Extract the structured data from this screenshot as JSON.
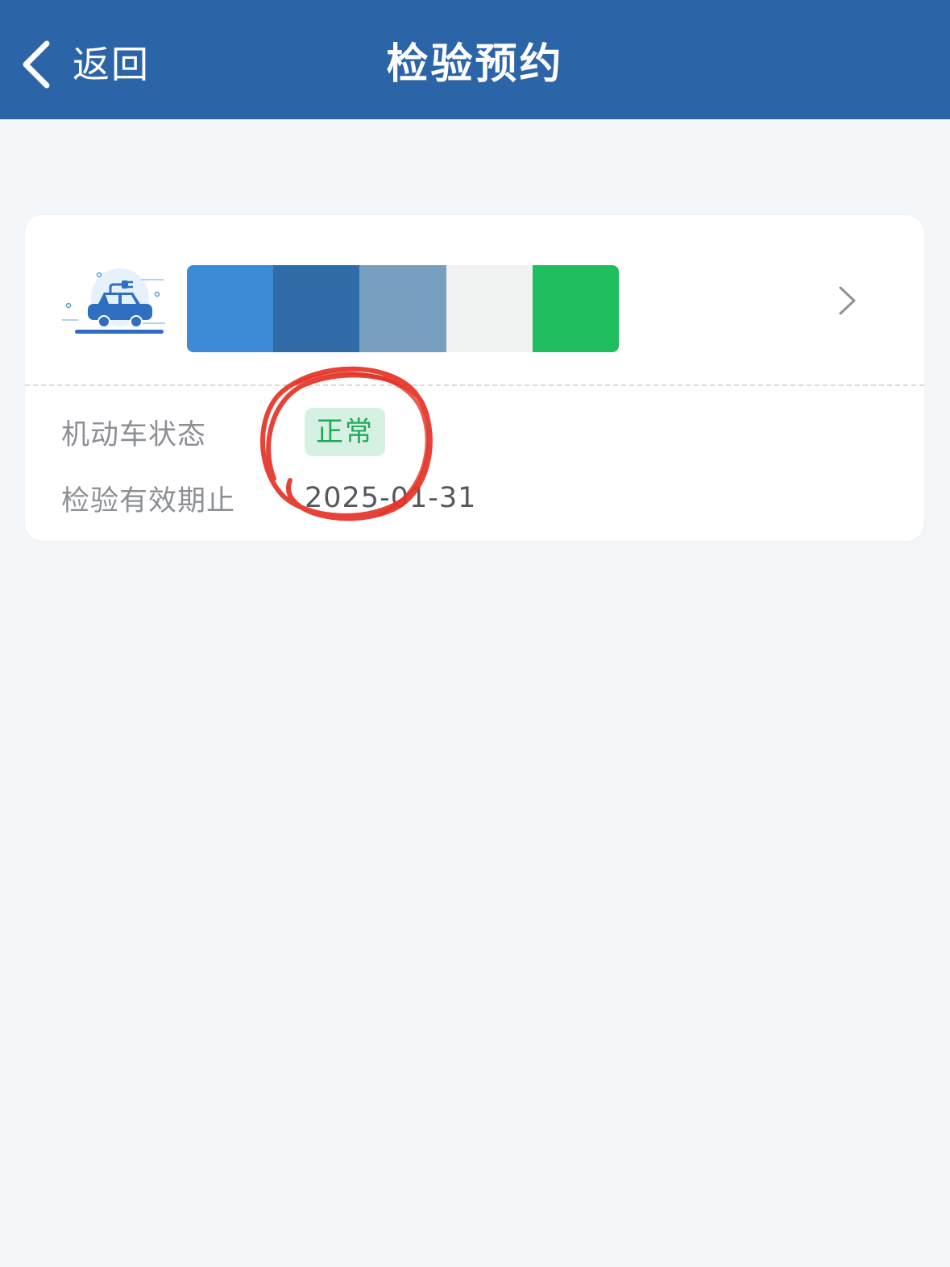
{
  "header": {
    "back_label": "返回",
    "title": "检验预约"
  },
  "vehicle": {
    "icon": "electric-car-icon",
    "plate_swatches": [
      "#3b8bd6",
      "#2f6ca8",
      "#789fbf",
      "#f1f2f2",
      "#1fbf60"
    ],
    "status_label": "机动车状态",
    "status_value": "正常",
    "expiry_label": "检验有效期止",
    "expiry_value": "2025-01-31"
  },
  "colors": {
    "nav_bar": "#2c64a8",
    "page_background": "#f3f7f9",
    "status_badge_bg": "#d6f1e3",
    "status_badge_text": "#21a859",
    "annotation": "#e53226"
  }
}
